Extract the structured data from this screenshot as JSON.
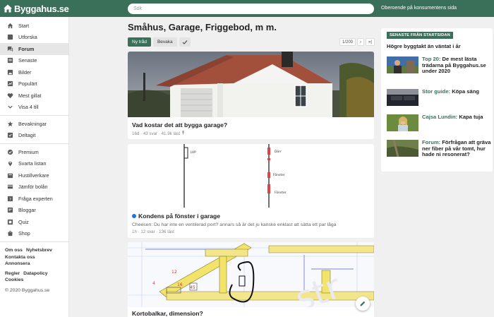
{
  "header": {
    "logo": "Byggahus.se",
    "search_placeholder": "Sök",
    "tagline": "Oberoende på konsumentens sida"
  },
  "sidebar": {
    "group1": [
      {
        "label": "Start",
        "icon": "home-icon"
      },
      {
        "label": "Utforska",
        "icon": "explore-icon"
      },
      {
        "label": "Forum",
        "icon": "forum-icon",
        "active": true
      },
      {
        "label": "Senaste",
        "icon": "latest-icon"
      },
      {
        "label": "Bilder",
        "icon": "images-icon"
      },
      {
        "label": "Populärt",
        "icon": "popular-icon"
      },
      {
        "label": "Mest gillat",
        "icon": "heart-icon"
      },
      {
        "label": "Visa 4 till",
        "icon": "chevron-down-icon"
      }
    ],
    "group2": [
      {
        "label": "Bevakningar",
        "icon": "star-icon"
      },
      {
        "label": "Deltagit",
        "icon": "participated-icon"
      }
    ],
    "group3": [
      {
        "label": "Premium",
        "icon": "premium-icon"
      },
      {
        "label": "Svarta listan",
        "icon": "pin-icon"
      },
      {
        "label": "Hustillverkare",
        "icon": "house-builder-icon"
      },
      {
        "label": "Jämför bolån",
        "icon": "loan-icon"
      },
      {
        "label": "Fråga experten",
        "icon": "expert-icon"
      },
      {
        "label": "Bloggar",
        "icon": "blog-icon"
      },
      {
        "label": "Quiz",
        "icon": "quiz-icon"
      },
      {
        "label": "Shop",
        "icon": "shop-icon"
      }
    ],
    "footer": {
      "link1": "Om oss",
      "link2": "Nyhetsbrev",
      "link3": "Kontakta oss",
      "link4": "Annonsera",
      "link5": "Regler",
      "link6": "Datapolicy",
      "link7": "Cookies",
      "copyright": "© 2020 Byggahus.se"
    }
  },
  "main": {
    "title": "Småhus, Garage, Friggebod, m m.",
    "new_thread": "Ny tråd",
    "watch": "Bevaka",
    "pager": {
      "label": "1/200",
      "next": "›",
      "last": "»|"
    },
    "threads": [
      {
        "title": "Vad kostar det att bygga garage?",
        "meta": "16d · 43 svar · 41.9k läst"
      },
      {
        "title": "Kondens på fönster i garage",
        "excerpt": "Cheesen: Du har inte en ventilerad port? annars så är det ju kanske enklast att sätta ett par låga",
        "meta": "1h · 12 svar · 136 läst",
        "drawing": {
          "lvp": "LVP",
          "door": "Dörr",
          "win1": "Fönster",
          "win2": "Fönster"
        }
      },
      {
        "title": "Kortobalkar, dimension?"
      }
    ]
  },
  "right": {
    "badge": "SENASTE FRÅN STARTSIDAN",
    "heading": "Högre byggtakt än väntat i år",
    "items": [
      {
        "accent": "Top 20:",
        "text": " De mest lästa trädarna på Byggahus.se under 2020"
      },
      {
        "accent": "Stor guide:",
        "text": " Köpa säng"
      },
      {
        "accent": "Cajsa Lundin:",
        "text": " Kapa tuja"
      },
      {
        "accent": "Forum:",
        "text": " Förfrågan att gräva ner fiber på vår tomt, hur hade ni resonerat?"
      }
    ]
  },
  "colors": {
    "brand": "#3a6f5a",
    "background": "#f0f0f0",
    "unread_dot": "#1a73e8"
  }
}
